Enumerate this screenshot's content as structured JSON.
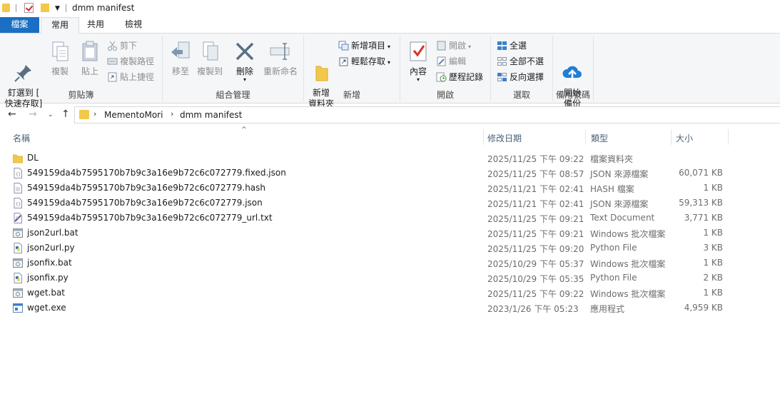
{
  "window": {
    "title": "dmm manifest"
  },
  "tabs": {
    "file": "檔案",
    "home": "常用",
    "share": "共用",
    "view": "檢視"
  },
  "ribbon": {
    "clipboard": {
      "label": "剪貼簿",
      "pin": "釘選到 [\n快速存取]",
      "copy": "複製",
      "paste": "貼上",
      "cut": "剪下",
      "copy_path": "複製路徑",
      "paste_shortcut": "貼上捷徑"
    },
    "organize": {
      "label": "組合管理",
      "move_to": "移至",
      "copy_to": "複製到",
      "delete": "刪除",
      "rename": "重新命名"
    },
    "new": {
      "label": "新增",
      "new_folder": "新增\n資料夾",
      "new_item": "新增項目",
      "easy_access": "輕鬆存取"
    },
    "open": {
      "label": "開啟",
      "properties": "內容",
      "open": "開啟",
      "edit": "編輯",
      "history": "歷程記錄"
    },
    "select": {
      "label": "選取",
      "select_all": "全選",
      "select_none": "全部不選",
      "invert": "反向選擇"
    },
    "backup": {
      "label": "備用號碼",
      "start_backup": "開始\n備份"
    }
  },
  "address": {
    "crumbs": [
      "MementoMori",
      "dmm manifest"
    ]
  },
  "columns": {
    "name": "名稱",
    "date": "修改日期",
    "type": "類型",
    "size": "大小"
  },
  "files": [
    {
      "name": "DL",
      "date": "2025/11/25 下午 09:22",
      "type": "檔案資料夾",
      "size": "",
      "icon": "folder-icon"
    },
    {
      "name": "549159da4b7595170b7b9c3a16e9b72c6c072779.fixed.json",
      "date": "2025/11/25 下午 08:57",
      "type": "JSON 來源檔案",
      "size": "60,071 KB",
      "icon": "json-file-icon"
    },
    {
      "name": "549159da4b7595170b7b9c3a16e9b72c6c072779.hash",
      "date": "2025/11/21 下午 02:41",
      "type": "HASH 檔案",
      "size": "1 KB",
      "icon": "generic-file-icon"
    },
    {
      "name": "549159da4b7595170b7b9c3a16e9b72c6c072779.json",
      "date": "2025/11/21 下午 02:41",
      "type": "JSON 來源檔案",
      "size": "59,313 KB",
      "icon": "json-file-icon"
    },
    {
      "name": "549159da4b7595170b7b9c3a16e9b72c6c072779_url.txt",
      "date": "2025/11/25 下午 09:21",
      "type": "Text Document",
      "size": "3,771 KB",
      "icon": "text-file-icon"
    },
    {
      "name": "json2url.bat",
      "date": "2025/11/25 下午 09:21",
      "type": "Windows 批次檔案",
      "size": "1 KB",
      "icon": "batch-file-icon"
    },
    {
      "name": "json2url.py",
      "date": "2025/11/25 下午 09:20",
      "type": "Python File",
      "size": "3 KB",
      "icon": "python-file-icon"
    },
    {
      "name": "jsonfix.bat",
      "date": "2025/10/29 下午 05:37",
      "type": "Windows 批次檔案",
      "size": "1 KB",
      "icon": "batch-file-icon"
    },
    {
      "name": "jsonfix.py",
      "date": "2025/10/29 下午 05:35",
      "type": "Python File",
      "size": "2 KB",
      "icon": "python-file-icon"
    },
    {
      "name": "wget.bat",
      "date": "2025/11/25 下午 09:22",
      "type": "Windows 批次檔案",
      "size": "1 KB",
      "icon": "batch-file-icon"
    },
    {
      "name": "wget.exe",
      "date": "2023/1/26 下午 05:23",
      "type": "應用程式",
      "size": "4,959 KB",
      "icon": "exe-file-icon"
    }
  ],
  "colors": {
    "file_tab": "#1a6fc4",
    "folder": "#f3c84a",
    "ribbon_bg": "#f5f6f7",
    "header_text": "#4c607a"
  }
}
